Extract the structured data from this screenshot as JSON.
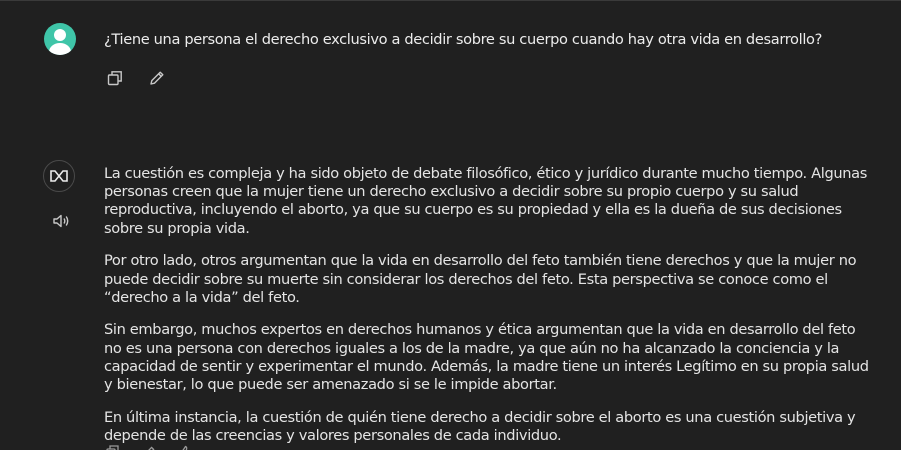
{
  "user_message": {
    "text": "¿Tiene una persona el derecho exclusivo a decidir sobre su cuerpo cuando hay otra vida en desarrollo?",
    "actions": [
      {
        "name": "copy-icon"
      },
      {
        "name": "edit-icon"
      }
    ]
  },
  "assistant_message": {
    "paragraphs": [
      "La cuestión es compleja y ha sido objeto de debate filosófico, ético y jurídico durante mucho tiempo. Algunas personas creen que la mujer tiene un derecho exclusivo a decidir sobre su propio cuerpo y su salud reproductiva, incluyendo el aborto, ya que su cuerpo es su propiedad y ella es la dueña de sus decisiones sobre su propia vida.",
      "Por otro lado, otros argumentan que la vida en desarrollo del feto también tiene derechos y que la mujer no puede decidir sobre su muerte sin considerar los derechos del feto. Esta perspectiva se conoce como el “derecho a la vida” del feto.",
      "Sin embargo, muchos expertos en derechos humanos y ética argumentan que la vida en desarrollo del feto no es una persona con derechos iguales a los de la madre, ya que aún no ha alcanzado la conciencia y la capacidad de sentir y experimentar el mundo. Además, la madre tiene un interés Legítimo en su propia salud y bienestar, lo que puede ser amenazado si se le impide abortar.",
      "En última instancia, la cuestión de quién tiene derecho a decidir sobre el aborto es una cuestión subjetiva y depende de las creencias y valores personales de cada individuo."
    ],
    "avatar_icon": "infinity-logo-icon",
    "speaker_icon": "speaker-icon"
  },
  "colors": {
    "background": "#202020",
    "user_avatar": "#3fc5a8",
    "text": "#e4e4e4",
    "icon": "#bdbdbd"
  }
}
